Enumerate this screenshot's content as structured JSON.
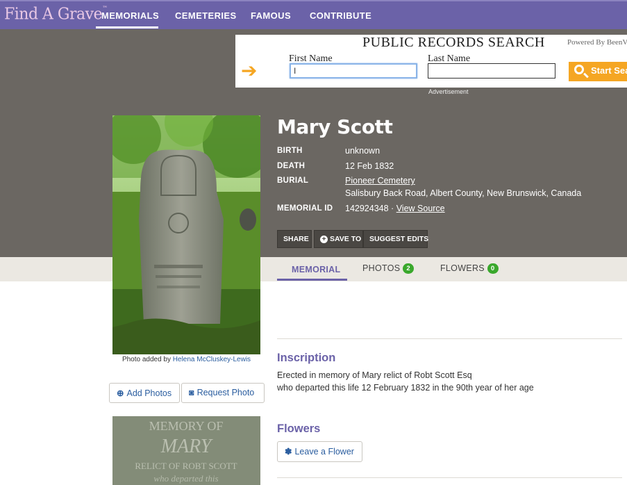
{
  "header": {
    "logo": "Find A Grave",
    "nav": [
      "MEMORIALS",
      "CEMETERIES",
      "FAMOUS",
      "CONTRIBUTE"
    ]
  },
  "ad": {
    "title": "PUBLIC RECORDS SEARCH",
    "powered_by": "Powered By BeenVerified",
    "first_name_label": "First Name",
    "last_name_label": "Last Name",
    "first_name_value": "I",
    "last_name_value": "",
    "button": "Start Search",
    "advert_label": "Advertisement"
  },
  "memorial": {
    "name": "Mary Scott",
    "birth_label": "BIRTH",
    "birth_value": "unknown",
    "death_label": "DEATH",
    "death_value": "12 Feb 1832",
    "burial_label": "BURIAL",
    "burial_cemetery": "Pioneer Cemetery",
    "burial_location": "Salisbury Back Road, Albert County, New Brunswick, Canada",
    "memorial_id_label": "MEMORIAL ID",
    "memorial_id_value": "142924348 ·",
    "view_source": "View Source",
    "actions": [
      "SHARE",
      "SAVE TO",
      "SUGGEST EDITS"
    ]
  },
  "photo": {
    "caption_prefix": "Photo added by",
    "added_by": "Helena McCluskey-Lewis",
    "add_photos": "Add Photos",
    "request_photo": "Request Photo"
  },
  "tabs": [
    {
      "label": "MEMORIAL"
    },
    {
      "label": "PHOTOS",
      "badge": "2"
    },
    {
      "label": "FLOWERS",
      "badge": "0"
    }
  ],
  "inscription": {
    "heading": "Inscription",
    "line1": "Erected in memory of Mary relict of Robt Scott Esq",
    "line2": "who departed this life 12 February 1832 in the 90th year of her age"
  },
  "flowers": {
    "heading": "Flowers",
    "button": "Leave a Flower"
  },
  "colors": {
    "brand_purple": "#6b62a8",
    "hero_gray": "#6b6762",
    "badge_green": "#3aa82c",
    "ad_orange": "#f5a623"
  }
}
